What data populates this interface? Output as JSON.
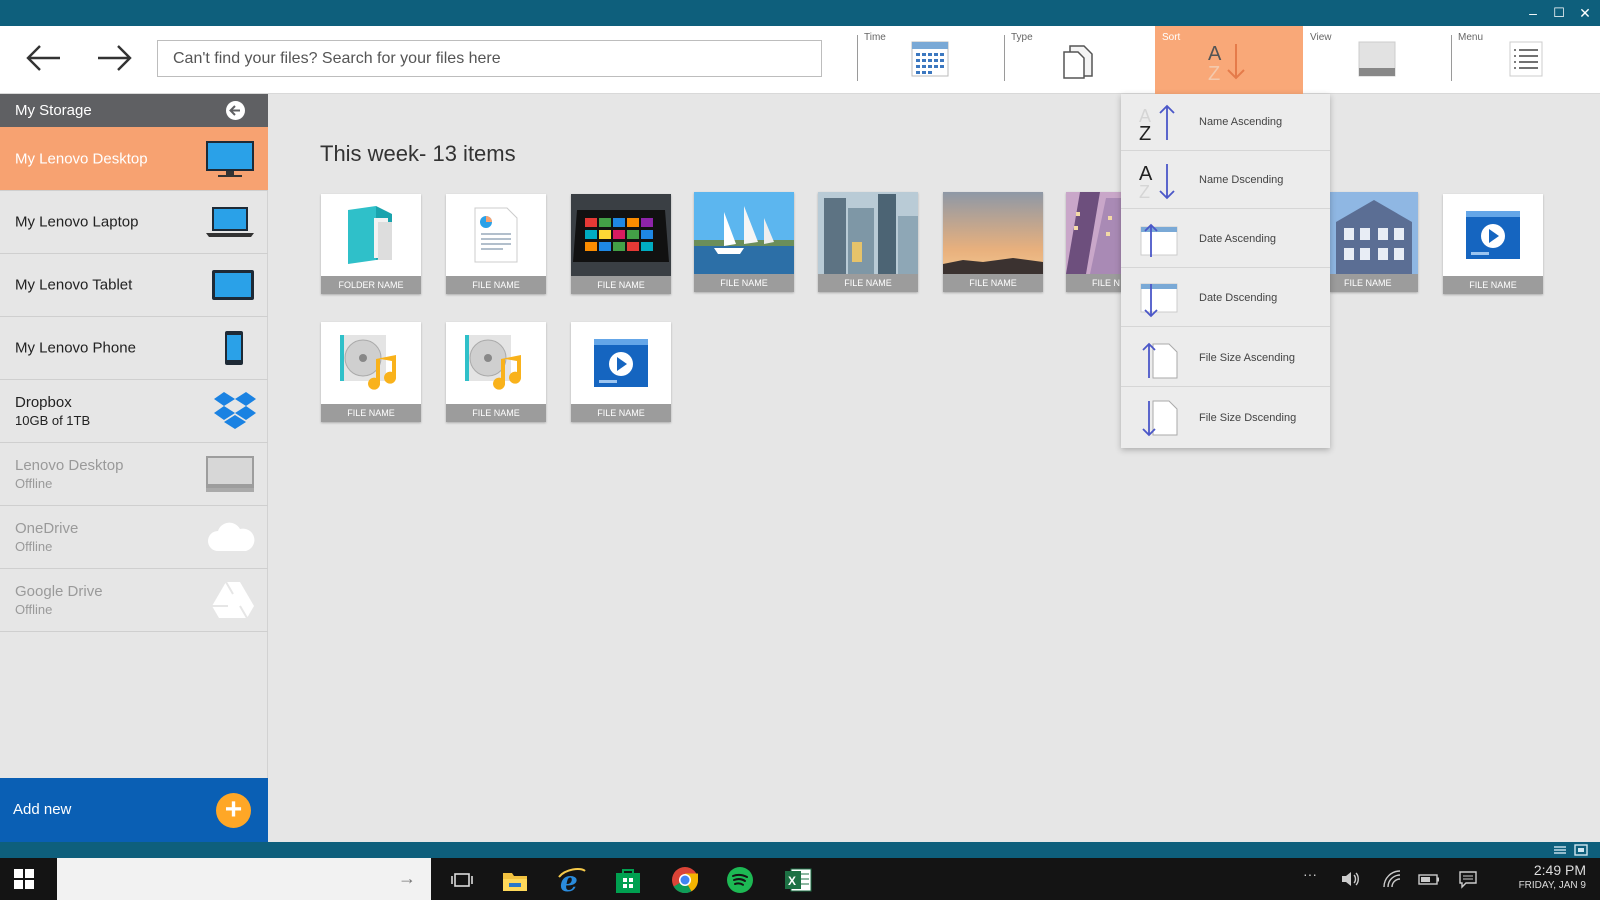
{
  "titlebar": {
    "minimize": "–",
    "maximize": "☐",
    "close": "✕"
  },
  "toolbar": {
    "search_placeholder": "Can't find your files? Search for your files here",
    "tools": [
      {
        "label": "Time",
        "icon": "calendar-icon"
      },
      {
        "label": "Type",
        "icon": "document-icon"
      },
      {
        "label": "Sort",
        "icon": "sort-az-icon",
        "active": true
      },
      {
        "label": "View",
        "icon": "view-icon"
      },
      {
        "label": "Menu",
        "icon": "list-icon"
      }
    ]
  },
  "sidebar": {
    "header": "My Storage",
    "items": [
      {
        "label": "My Lenovo Desktop",
        "sub": "",
        "icon": "desktop-icon",
        "active": true
      },
      {
        "label": "My Lenovo Laptop",
        "sub": "",
        "icon": "laptop-icon"
      },
      {
        "label": "My Lenovo Tablet",
        "sub": "",
        "icon": "tablet-icon"
      },
      {
        "label": "My Lenovo Phone",
        "sub": "",
        "icon": "phone-icon"
      },
      {
        "label": "Dropbox",
        "sub": "10GB of 1TB",
        "icon": "dropbox-icon"
      },
      {
        "label": "Lenovo Desktop",
        "sub": "Offline",
        "icon": "desktop-icon",
        "offline": true
      },
      {
        "label": "OneDrive",
        "sub": "Offline",
        "icon": "cloud-icon",
        "offline": true
      },
      {
        "label": "Google Drive",
        "sub": "Offline",
        "icon": "google-drive-icon",
        "offline": true
      }
    ],
    "add_new": "Add new"
  },
  "main": {
    "section_title": "This week- 13 items",
    "files": [
      {
        "name": "FOLDER NAME",
        "kind": "folder"
      },
      {
        "name": "FILE NAME",
        "kind": "document"
      },
      {
        "name": "FILE NAME",
        "kind": "tablet-photo"
      },
      {
        "name": "FILE NAME",
        "kind": "photo-harbor"
      },
      {
        "name": "FILE NAME",
        "kind": "photo-city"
      },
      {
        "name": "FILE NAME",
        "kind": "photo-sunset"
      },
      {
        "name": "FILE N",
        "kind": "photo-buildings"
      },
      {
        "name": "FILE NAME",
        "kind": "photo-house"
      },
      {
        "name": "FILE NAME",
        "kind": "video"
      },
      {
        "name": "FILE NAME",
        "kind": "music"
      },
      {
        "name": "FILE NAME",
        "kind": "music"
      },
      {
        "name": "FILE NAME",
        "kind": "video"
      }
    ]
  },
  "sort_menu": {
    "options": [
      {
        "label": "Name Ascending",
        "icon": "sort-za-up-icon"
      },
      {
        "label": "Name Dscending",
        "icon": "sort-az-down-icon"
      },
      {
        "label": "Date Ascending",
        "icon": "date-up-icon"
      },
      {
        "label": "Date Dscending",
        "icon": "date-down-icon"
      },
      {
        "label": "File Size Ascending",
        "icon": "size-up-icon"
      },
      {
        "label": "File Size Dscending",
        "icon": "size-down-icon"
      }
    ]
  },
  "taskbar": {
    "search_arrow": "→",
    "apps": [
      "task-view-icon",
      "file-explorer-icon",
      "internet-explorer-icon",
      "store-icon",
      "chrome-icon",
      "spotify-icon",
      "excel-icon"
    ],
    "tray_more": "···",
    "time": "2:49 PM",
    "date": "FRIDAY, JAN 9"
  },
  "colors": {
    "accent": "#f7a271",
    "titlebar": "#0e5f7c",
    "add_new": "#0a5fb4"
  }
}
